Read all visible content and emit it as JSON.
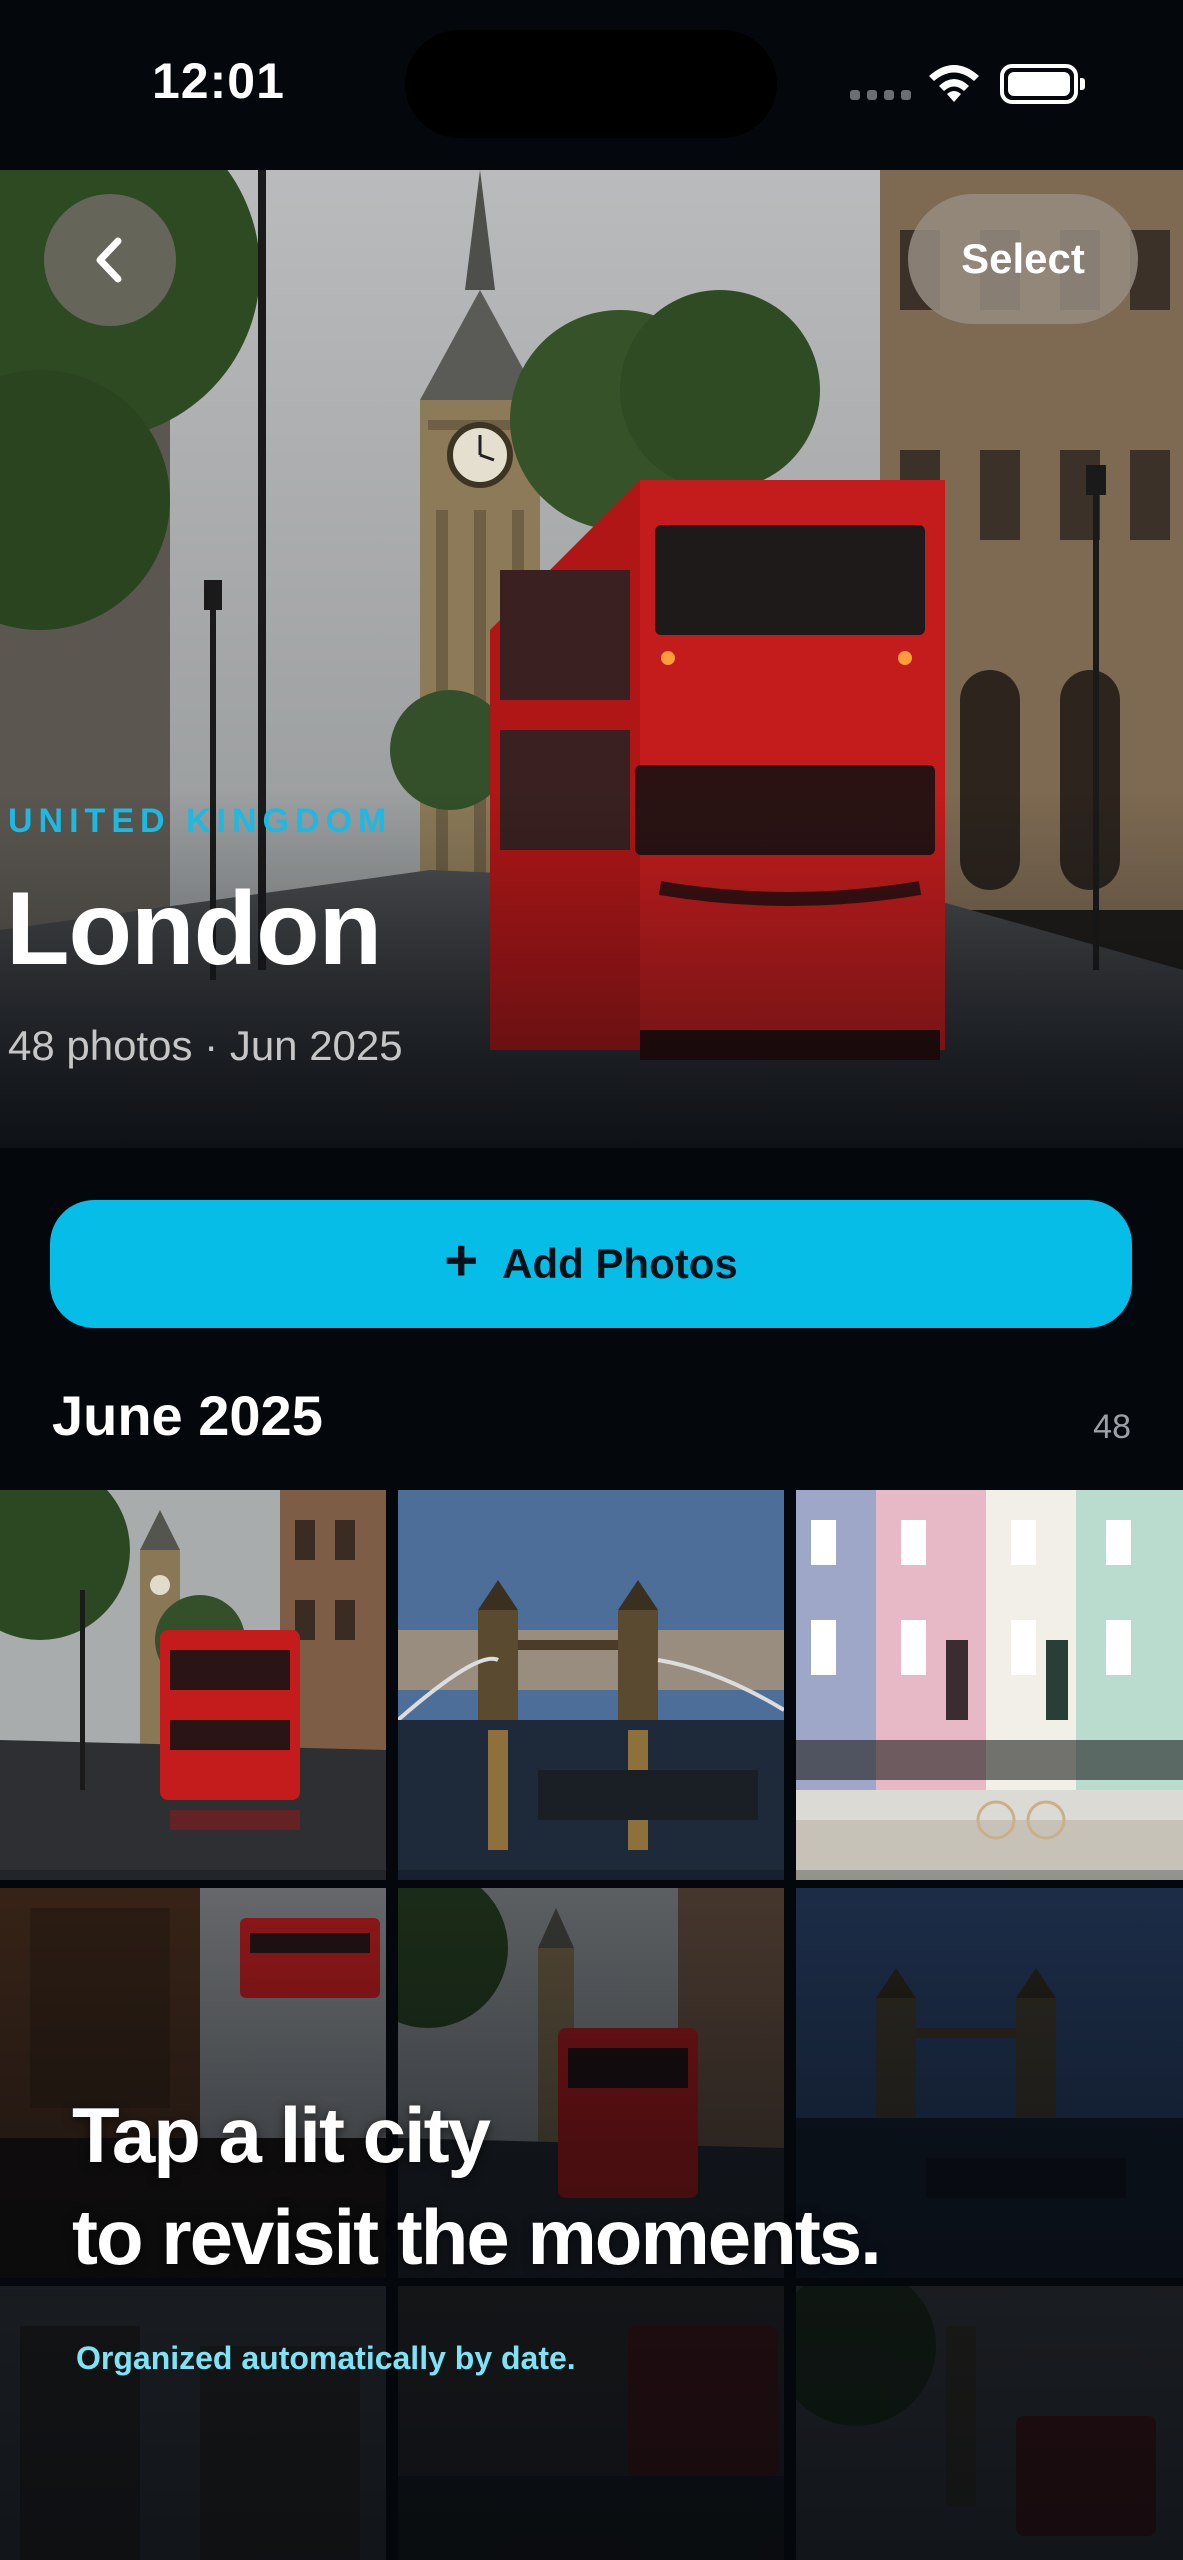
{
  "status_bar": {
    "time": "12:01"
  },
  "nav": {
    "back_icon": "chevron-left-icon",
    "select_label": "Select"
  },
  "hero": {
    "country": "UNITED KINGDOM",
    "city": "London",
    "meta": "48 photos · Jun 2025"
  },
  "add_photos": {
    "icon": "plus-icon",
    "label": "Add Photos"
  },
  "section": {
    "title": "June 2025",
    "count": "48"
  },
  "photos": [
    {
      "subject": "big-ben-red-bus"
    },
    {
      "subject": "tower-bridge-dusk"
    },
    {
      "subject": "pastel-houses"
    },
    {
      "subject": "bus-through-window"
    },
    {
      "subject": "big-ben-red-bus-dark"
    },
    {
      "subject": "tower-bridge-night"
    }
  ],
  "caption": {
    "line1": "Tap a lit city",
    "line2": "to revisit the moments.",
    "sub": "Organized automatically by date."
  },
  "colors": {
    "accent": "#05bde6",
    "bus_red": "#c01a1a",
    "background": "#04080d"
  }
}
